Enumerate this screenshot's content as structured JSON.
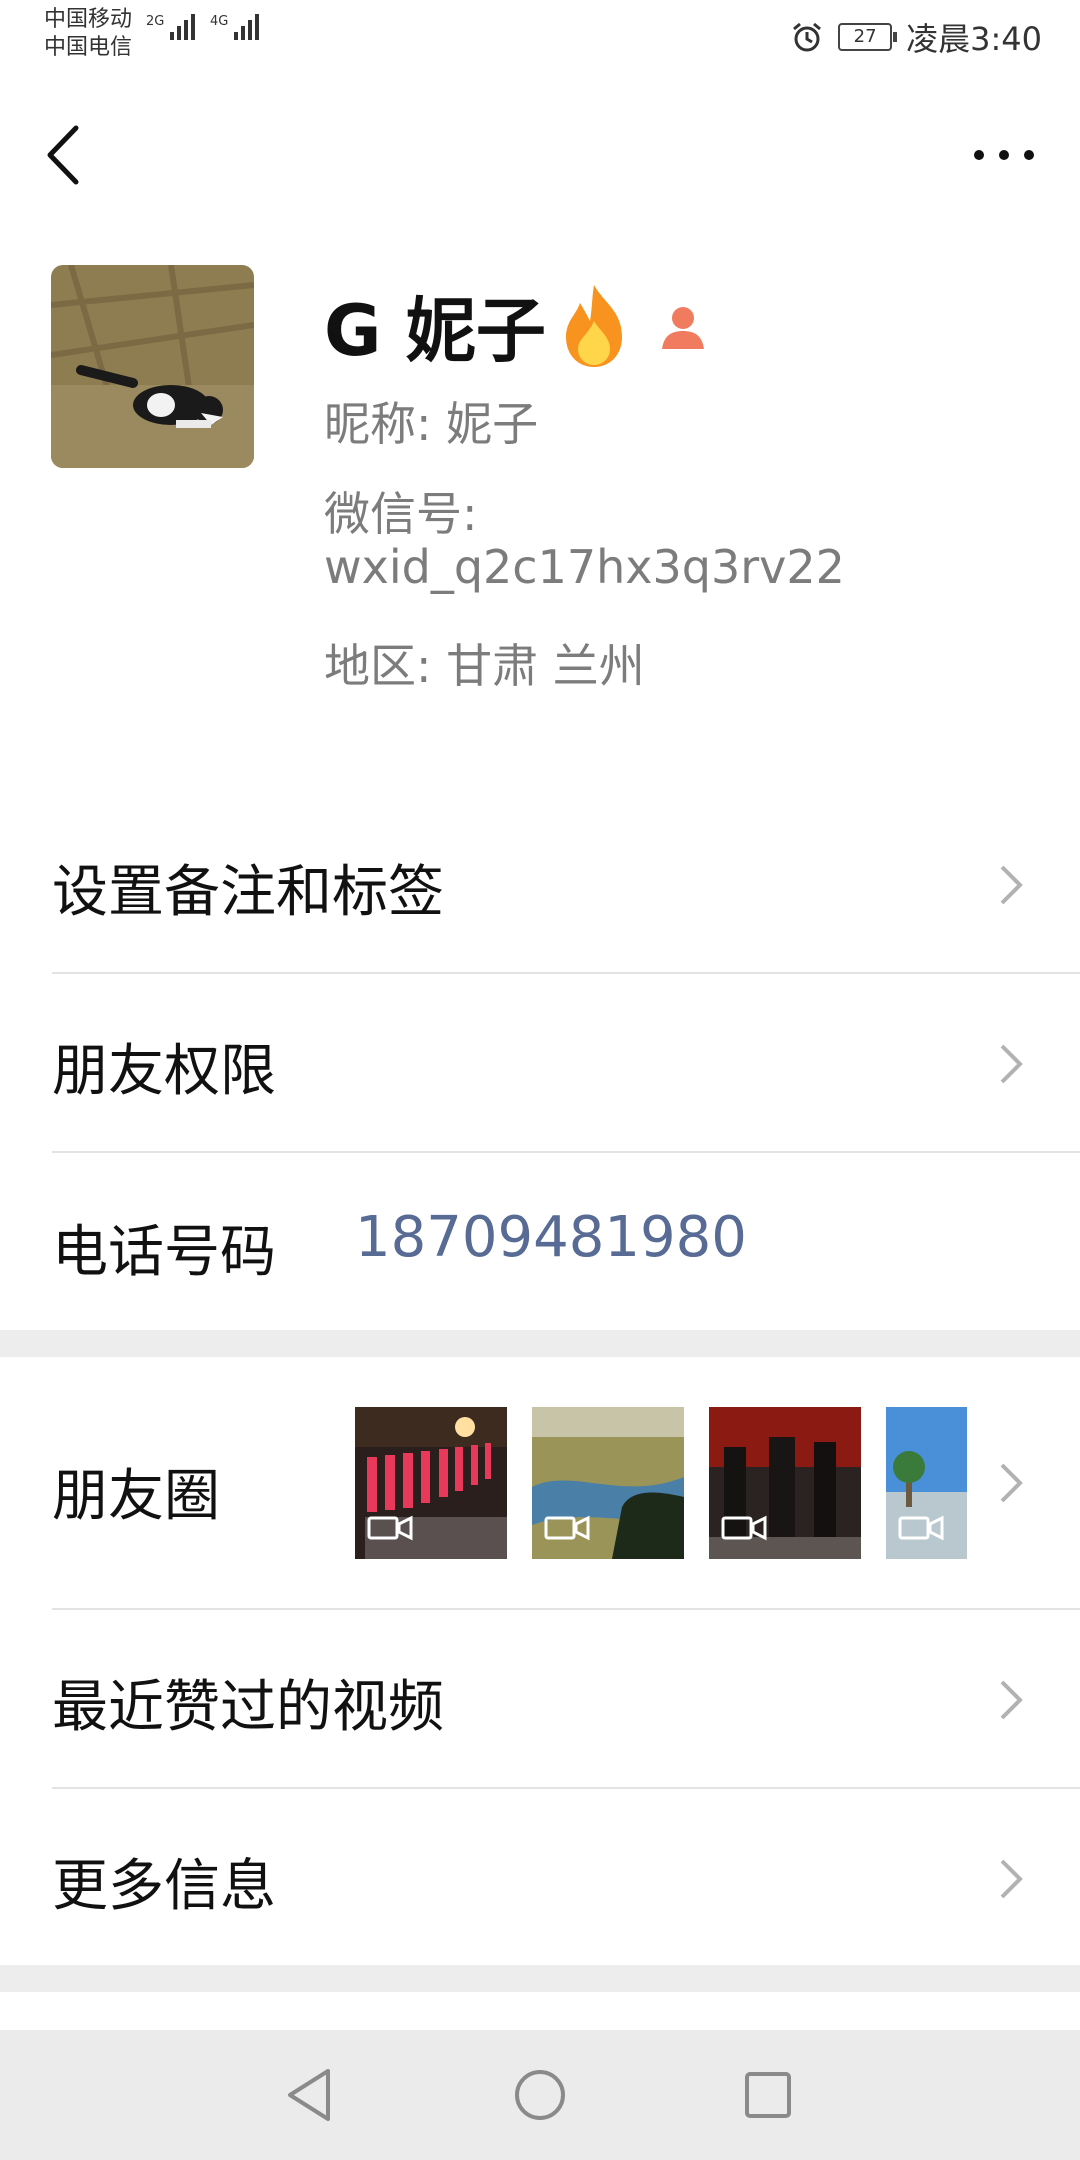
{
  "status_bar": {
    "carrier_1": "中国移动",
    "carrier_2": "中国电信",
    "net_1": "2G",
    "net_2": "4G",
    "battery": "27",
    "time": "凌晨3:40"
  },
  "profile": {
    "display_name": "G 妮子",
    "nickname": "昵称: 妮子",
    "wechat_id_label": "微信号:",
    "wechat_id": "wxid_q2c17hx3q3rv22",
    "region": "地区: 甘肃  兰州"
  },
  "menu": {
    "remark_tags": "设置备注和标签",
    "friend_permissions": "朋友权限",
    "phone_label": "电话号码",
    "phone_number": "18709481980",
    "moments": "朋友圈",
    "liked_videos": "最近赞过的视频",
    "more_info": "更多信息"
  },
  "icons": {
    "back": "back-arrow-icon",
    "more": "more-dots-icon",
    "fire": "fire-icon",
    "gender": "female-user-icon",
    "chevron": "chevron-right-icon",
    "video": "video-icon",
    "nav_back": "triangle-back-icon",
    "nav_home": "circle-home-icon",
    "nav_recent": "square-recent-icon"
  },
  "colors": {
    "link_blue": "#576b95",
    "gender_icon": "#f07b5e"
  }
}
